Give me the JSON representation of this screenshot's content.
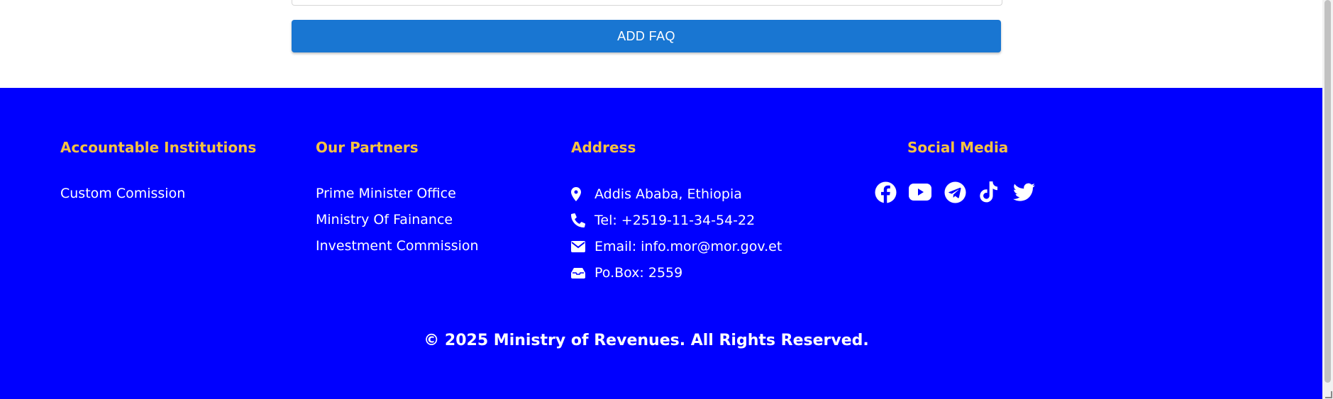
{
  "form": {
    "add_button_label": "ADD FAQ"
  },
  "footer": {
    "accountable": {
      "heading": "Accountable Institutions",
      "links": [
        "Custom Comission"
      ]
    },
    "partners": {
      "heading": "Our Partners",
      "links": [
        "Prime Minister Office",
        "Ministry Of Fainance",
        "Investment Commission"
      ]
    },
    "address": {
      "heading": "Address",
      "items": [
        {
          "icon": "map-pin-icon",
          "text": "Addis Ababa, Ethiopia"
        },
        {
          "icon": "phone-icon",
          "text": "Tel: +2519-11-34-54-22"
        },
        {
          "icon": "envelope-icon",
          "text": "Email: info.mor@mor.gov.et"
        },
        {
          "icon": "inbox-icon",
          "text": "Po.Box: 2559"
        }
      ]
    },
    "social": {
      "heading": "Social Media",
      "icons": [
        "facebook-icon",
        "youtube-icon",
        "telegram-icon",
        "tiktok-icon",
        "twitter-icon"
      ]
    },
    "copyright": "© 2025 Ministry of Revenues. All Rights Reserved."
  },
  "colors": {
    "footer_background": "#0000ff",
    "heading": "#f5c242",
    "button": "#1976d2",
    "text": "#ffffff"
  }
}
